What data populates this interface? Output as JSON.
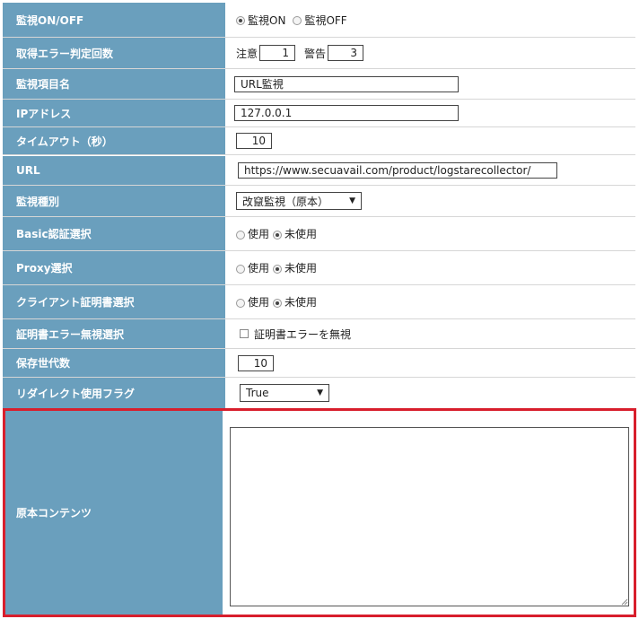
{
  "rows": {
    "monitor": {
      "label": "監視ON/OFF",
      "opt_on": "監視ON",
      "opt_off": "監視OFF"
    },
    "errors": {
      "label": "取得エラー判定回数",
      "caution_label": "注意",
      "caution_value": "1",
      "warning_label": "警告",
      "warning_value": "3"
    },
    "item_name": {
      "label": "監視項目名",
      "value": "URL監視"
    },
    "ip": {
      "label": "IPアドレス",
      "value": "127.0.0.1"
    },
    "timeout": {
      "label": "タイムアウト（秒）",
      "value": "10"
    },
    "url": {
      "label": "URL",
      "value": "https://www.secuavail.com/product/logstarecollector/"
    },
    "monitor_type": {
      "label": "監視種別",
      "value": "改竄監視（原本）"
    },
    "basic_auth": {
      "label": "Basic認証選択",
      "opt_use": "使用",
      "opt_nouse": "未使用"
    },
    "proxy": {
      "label": "Proxy選択",
      "opt_use": "使用",
      "opt_nouse": "未使用"
    },
    "client_cert": {
      "label": "クライアント証明書選択",
      "opt_use": "使用",
      "opt_nouse": "未使用"
    },
    "cert_error": {
      "label": "証明書エラー無視選択",
      "checkbox_label": "証明書エラーを無視"
    },
    "generations": {
      "label": "保存世代数",
      "value": "10"
    },
    "redirect": {
      "label": "リダイレクト使用フラグ",
      "value": "True"
    },
    "original": {
      "label": "原本コンテンツ",
      "value": ""
    }
  }
}
